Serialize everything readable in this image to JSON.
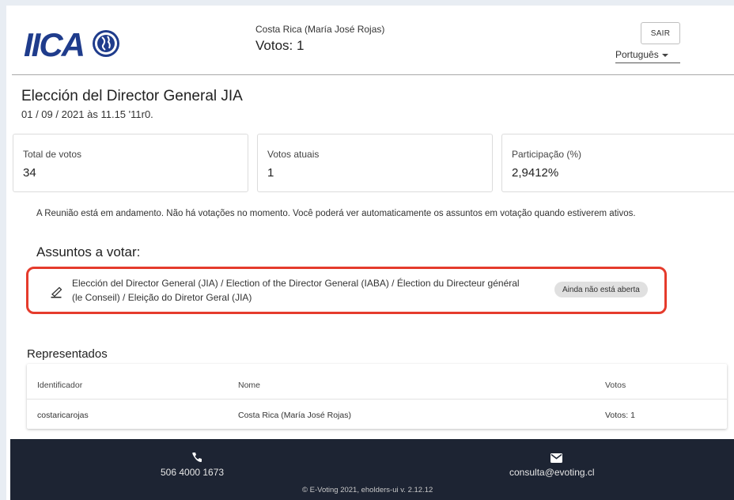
{
  "header": {
    "logo_text": "IICA",
    "user_name": "Costa Rica (María José Rojas)",
    "votes": "Votos: 1",
    "logout_label": "SAIR",
    "language": "Português"
  },
  "election": {
    "title": "Elección del Director General JIA",
    "datetime": "01 / 09 / 2021 às 11.15 '11r0."
  },
  "stats": [
    {
      "label": "Total de votos",
      "value": "34"
    },
    {
      "label": "Votos atuais",
      "value": "1"
    },
    {
      "label": "Participação (%)",
      "value": "2,9412%"
    }
  ],
  "status_message": "A Reunião está em andamento. Não há votações no momento. Você poderá ver automaticamente os assuntos em votação quando estiverem ativos.",
  "agenda": {
    "title": "Assuntos a votar:",
    "items": [
      {
        "icon": "ballot-icon",
        "text": "Elección del Director General (JIA) / Election of the Director General (IABA) / Élection du Directeur général (le Conseil) / Eleição do Diretor Geral (JIA)",
        "status": "Ainda não está aberta"
      }
    ]
  },
  "represented": {
    "title": "Representados",
    "columns": [
      "Identificador",
      "Nome",
      "Votos"
    ],
    "rows": [
      [
        "costaricarojas",
        "Costa Rica (María José Rojas)",
        "Votos: 1"
      ]
    ]
  },
  "footer": {
    "phone": "506 4000 1673",
    "email": "consulta@evoting.cl",
    "copyright": "© E-Voting 2021, eholders-ui v. 2.12.12"
  },
  "colors": {
    "highlight_border": "#e53b2c",
    "footer_bg": "#1d2433",
    "logo_blue": "#1f3c8c"
  }
}
